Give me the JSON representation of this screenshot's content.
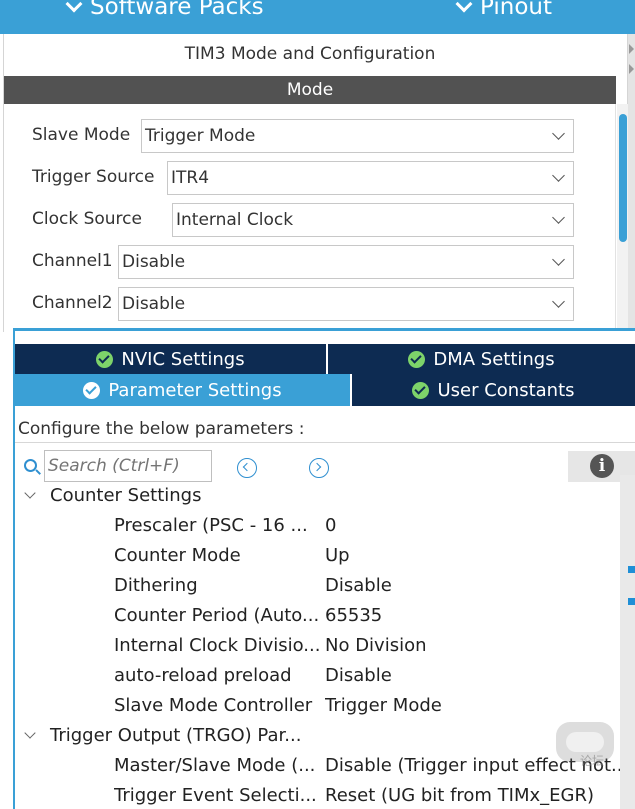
{
  "header": {
    "tabs": [
      {
        "label": "Software Packs"
      },
      {
        "label": "Pinout"
      }
    ]
  },
  "mode_panel": {
    "title": "TIM3 Mode and Configuration",
    "section": "Mode",
    "fields": [
      {
        "label": "Slave Mode",
        "value": "Trigger Mode"
      },
      {
        "label": "Trigger Source",
        "value": "ITR4"
      },
      {
        "label": "Clock Source",
        "value": "Internal Clock"
      },
      {
        "label": "Channel1",
        "value": "Disable"
      },
      {
        "label": "Channel2",
        "value": "Disable"
      }
    ]
  },
  "config_panel": {
    "tabs": [
      {
        "label": "NVIC Settings",
        "active": false
      },
      {
        "label": "DMA Settings",
        "active": false
      },
      {
        "label": "Parameter Settings",
        "active": true
      },
      {
        "label": "User Constants",
        "active": false
      }
    ],
    "hint": "Configure the below parameters :",
    "search": {
      "placeholder": "Search (Ctrl+F)"
    },
    "info_icon": "i",
    "groups": [
      {
        "label": "Counter Settings",
        "params": [
          {
            "name": "Prescaler (PSC - 16 ...",
            "value": "0"
          },
          {
            "name": "Counter Mode",
            "value": "Up"
          },
          {
            "name": "Dithering",
            "value": "Disable"
          },
          {
            "name": "Counter Period (Auto...",
            "value": "65535"
          },
          {
            "name": "Internal Clock Divisio...",
            "value": "No Division"
          },
          {
            "name": "auto-reload preload",
            "value": "Disable"
          },
          {
            "name": "Slave Mode Controller",
            "value": "Trigger Mode"
          }
        ]
      },
      {
        "label": "Trigger Output (TRGO) Par...",
        "params": [
          {
            "name": "Master/Slave Mode (...",
            "value": "Disable (Trigger input effect not..."
          },
          {
            "name": "Trigger Event Selecti...",
            "value": "Reset (UG bit from TIMx_EGR)"
          }
        ]
      }
    ]
  },
  "watermark": "论坛",
  "colors": {
    "accent": "#3aa0d6",
    "tab_dark": "#0d2b52",
    "mode_bar": "#525252",
    "check_green": "#7dd36a"
  },
  "icons": [
    "chevron-down-icon",
    "check-circle-icon",
    "search-icon",
    "arrow-left-circle-icon",
    "arrow-right-circle-icon",
    "info-icon"
  ]
}
